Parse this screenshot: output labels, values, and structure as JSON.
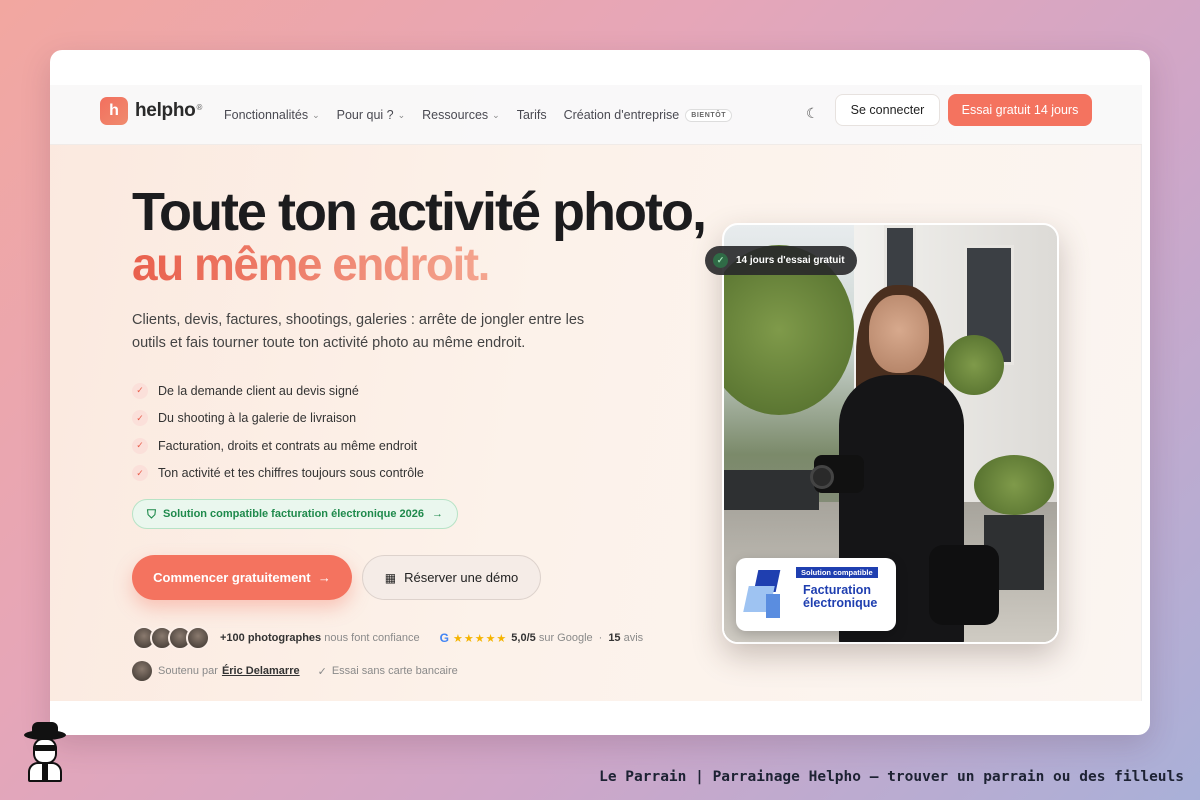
{
  "nav": {
    "logo_text": "helpho",
    "logo_sup": "®",
    "logo_mark": "h",
    "menu": [
      {
        "label": "Fonctionnalités",
        "dropdown": true
      },
      {
        "label": "Pour qui ?",
        "dropdown": true
      },
      {
        "label": "Ressources",
        "dropdown": true
      },
      {
        "label": "Tarifs",
        "dropdown": false
      },
      {
        "label": "Création d'entreprise",
        "dropdown": false
      }
    ],
    "soon_badge": "BIENTÔT",
    "theme_icon": "moon-icon",
    "login_label": "Se connecter",
    "trial_label": "Essai gratuit 14 jours"
  },
  "hero": {
    "title_line1": "Toute ton activité photo,",
    "title_line2": "au même endroit.",
    "subtitle": "Clients, devis, factures, shootings, galeries : arrête de jongler entre les outils et fais tourner toute ton activité photo au même endroit.",
    "features": [
      "De la demande client au devis signé",
      "Du shooting à la galerie de livraison",
      "Facturation, droits et contrats au même endroit",
      "Ton activité et tes chiffres toujours sous contrôle"
    ],
    "compliance_pill": "Solution compatible facturation électronique 2026",
    "cta_primary": "Commencer gratuitement",
    "cta_secondary": "Réserver une démo",
    "social": {
      "count": "+100 photographes",
      "trust": "nous font confiance",
      "google_letter": "G",
      "stars": "★★★★★",
      "rating": "5,0/5",
      "rating_source": "sur Google",
      "reviews": "15",
      "reviews_label": "avis"
    },
    "support": {
      "label": "Soutenu par",
      "name": "Éric Delamarre",
      "no_card": "Essai sans carte bancaire"
    }
  },
  "photo": {
    "trial_badge": "14 jours d'essai gratuit",
    "fe_tag": "Solution compatible",
    "fe_title_1": "Facturation",
    "fe_title_2": "électronique"
  },
  "footer": {
    "caption": "Le Parrain | Parrainage Helpho — trouver un parrain ou des filleuls"
  },
  "colors": {
    "accent": "#f4735f",
    "green": "#1f8a4c",
    "fe_blue": "#1f3fb0"
  }
}
